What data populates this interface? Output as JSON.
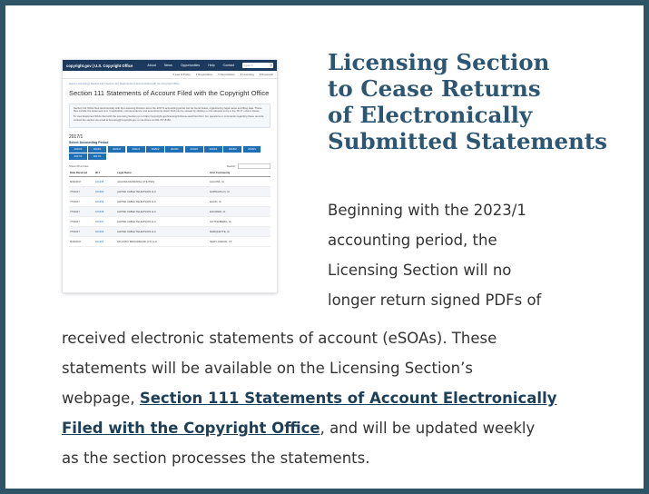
{
  "headline_lines": [
    "Licensing Section",
    "to Cease Returns",
    "of Electronically",
    "Submitted Statements"
  ],
  "lead_lines": [
    "Beginning with the 2023/1",
    "accounting period, the",
    "Licensing Section will no",
    "longer return signed PDFs of"
  ],
  "body": {
    "line1": "received electronic statements of account (eSOAs). These",
    "line2": "statements will be available on the Licensing Section’s",
    "line3_prefix": "webpage, ",
    "link_part1": "Section 111 Statements of Account Electronically",
    "link_part2": "Filed with the Copyright Office",
    "line4_suffix": ", and will be updated weekly",
    "line5": "as the section processes the statements."
  },
  "screenshot": {
    "logo": "copyright.gov | U.S. Copyright Office",
    "top_nav": [
      "About",
      "News",
      "Opportunities",
      "Help",
      "Contact"
    ],
    "search_placeholder": "Search",
    "sub_nav": [
      "▾ Law & Policy",
      "▾ Registration",
      "▾ Recordation",
      "▾ Licensing",
      "▾ Research"
    ],
    "breadcrumb": "Home | Licensing | Section 111 | Section 111 Statements of Account Filed with the Copyright Office",
    "title": "Section 111 Statements of Account Filed with the Copyright Office",
    "info_p1": "Section 111 SOAs filed electronically with the Licensing Division since the 2017/1 accounting period can be found below, organized by legal name and filing date. These files include the statement text, if applicable, correspondence and amendments. Each SOA can be viewed by clicking on the relevant entry in the \"ID #\" column below.",
    "info_p2": "To view Examined SOAs filed with the Licensing Section go to https://copyright.gov/licensing/111/soa-searchsel.html. For questions or comments regarding these records, contact the section via email at licensing@copyright.gov or via phone at 202-707-8150.",
    "year": "2017/1",
    "select_label": "Select Accounting Period",
    "periods": [
      "2022/2",
      "2022/1",
      "2021/2",
      "2021/1",
      "2020/2",
      "2020/1",
      "2019/2",
      "2019/1",
      "2018/2",
      "2018/1",
      "2017/2",
      "2017/1"
    ],
    "show_label": "Show",
    "show_value": "25",
    "entries_label": "entries",
    "search_label": "Search:",
    "columns": [
      "Date Received",
      "ID #",
      "Legal Name",
      "First Community"
    ],
    "rows": [
      [
        "8/24/2017",
        "101235",
        "ALGONA MUNICIPAL UTILITIES",
        "ALGONA, IA"
      ],
      [
        "7/5/2017",
        "101460",
        "ALPINE CABLE TELEVISION LLC",
        "GARNAVILLO, IA"
      ],
      [
        "7/5/2017",
        "101456",
        "ALPINE CABLE TELEVISION LLC",
        "ELGIN, IA"
      ],
      [
        "7/5/2017",
        "101535",
        "ALPINE CABLE TELEVISION LLC",
        "ELKADER, IA"
      ],
      [
        "7/5/2017",
        "101537",
        "ALPINE CABLE TELEVISION LLC",
        "GUTTENBERG, IA"
      ],
      [
        "7/5/2017",
        "101463",
        "ALPINE CABLE TELEVISION LLC",
        "MARQUETTE, IA"
      ],
      [
        "8/29/2017",
        "101451",
        "ATLANTIC BROADBAND (CT) LLC",
        "NEW LONDON, CT"
      ]
    ]
  },
  "colors": {
    "frame": "#2f5468",
    "headline": "#2d5672",
    "link": "#1d3f57",
    "period_button": "#1f6fb5",
    "site_header": "#1c3a5e"
  }
}
